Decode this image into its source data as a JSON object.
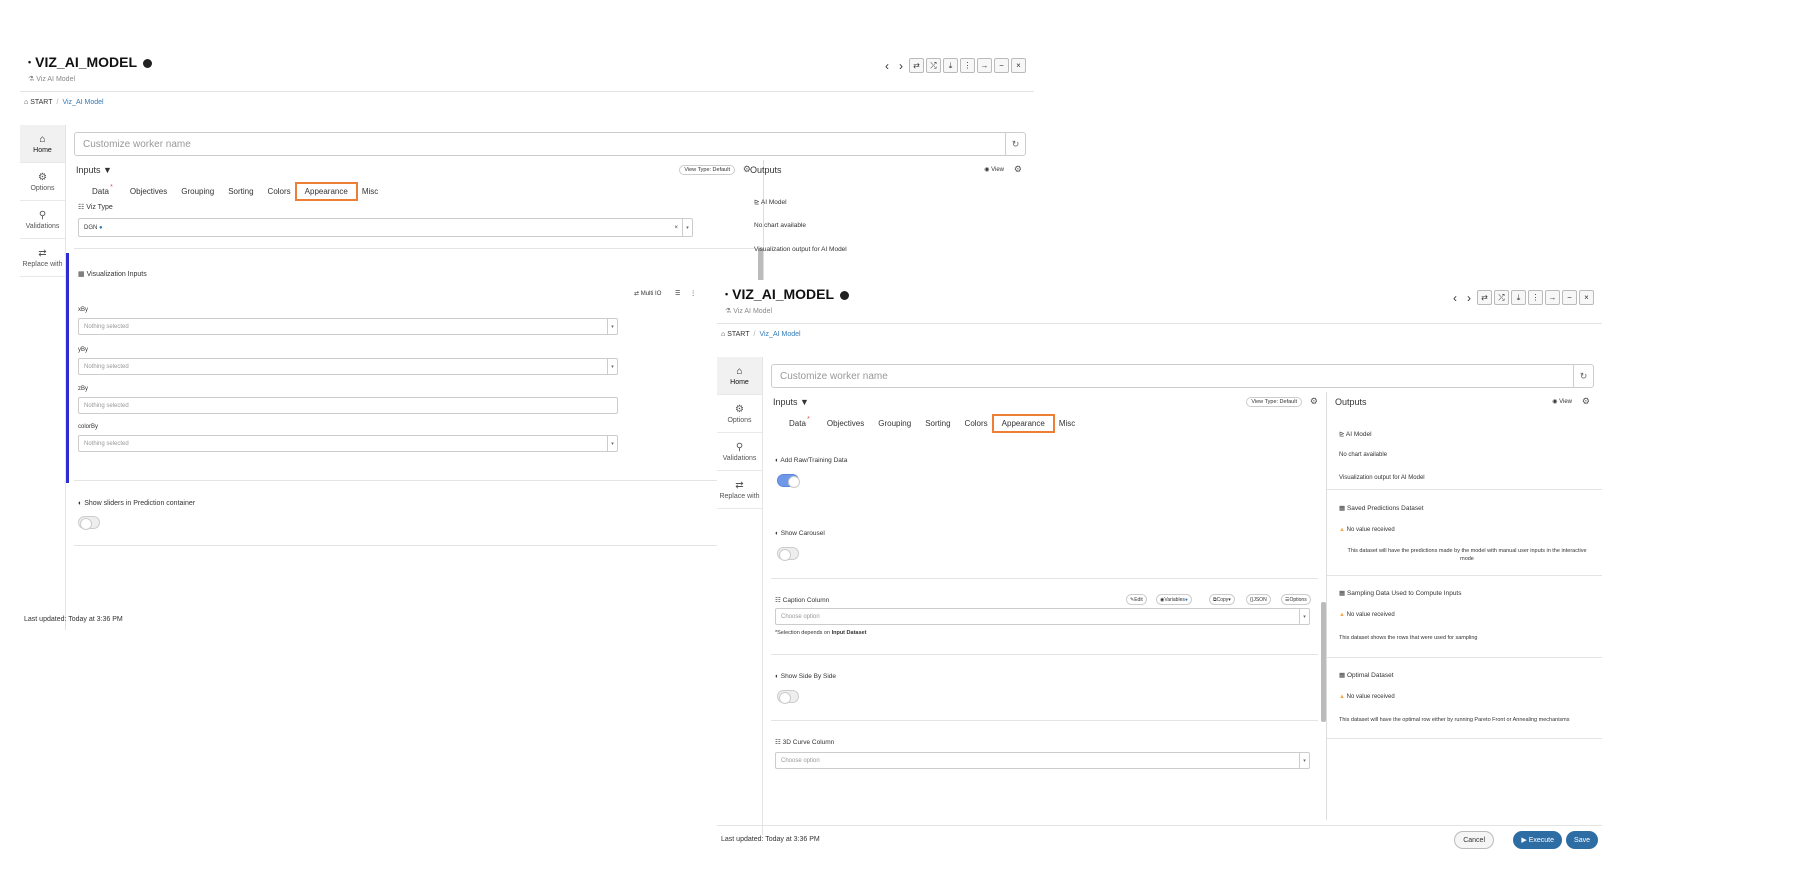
{
  "title": "VIZ_AI_MODEL",
  "subtitle": "Viz AI Model",
  "breadcrumb": {
    "start": "START",
    "current": "Viz_AI Model"
  },
  "worker_placeholder": "Customize worker name",
  "sidebar": [
    {
      "icon": "home-icon",
      "label": "Home"
    },
    {
      "icon": "gear-icon",
      "label": "Options"
    },
    {
      "icon": "check-icon",
      "label": "Validations"
    },
    {
      "icon": "swap-icon",
      "label": "Replace with"
    }
  ],
  "inputs_title": "Inputs",
  "view_type": "View Type: Default",
  "tabs": [
    "Data",
    "Objectives",
    "Grouping",
    "Sorting",
    "Colors",
    "Appearance",
    "Misc"
  ],
  "active_tab": "Appearance",
  "outputs_title": "Outputs",
  "view_label": "View",
  "w1": {
    "viz_type_label": "Viz Type",
    "viz_type_value": "DGN",
    "viz_inputs_label": "Visualization Inputs",
    "multi_io": "Multi IO",
    "fields": [
      {
        "label": "xBy",
        "value": "Nothing selected"
      },
      {
        "label": "yBy",
        "value": "Nothing selected"
      },
      {
        "label": "zBy",
        "value": "Nothing selected"
      },
      {
        "label": "colorBy",
        "value": "Nothing selected"
      }
    ],
    "sliders_label": "Show sliders in Prediction container",
    "outputs": {
      "ai_model": "AI Model",
      "no_chart": "No chart available",
      "viz_output": "Visualization output for AI Model"
    }
  },
  "w2": {
    "add_raw": "Add Raw/Training Data",
    "show_carousel": "Show Carousel",
    "caption_column": "Caption Column",
    "caption_buttons": [
      "Edit",
      "Variables",
      "Copy",
      "JSON",
      "Options"
    ],
    "choose": "Choose option",
    "selection_note": "*Selection depends on ",
    "selection_bold": "Input Dataset",
    "side_by_side": "Show Side By Side",
    "curve_column": "3D Curve Column",
    "outputs": [
      {
        "title": "AI Model",
        "line1": "No chart available",
        "line2": "Visualization output for AI Model"
      },
      {
        "title": "Saved Predictions Dataset",
        "warn": "No value received",
        "desc": "This dataset will have the predictions made by the model with manual user inputs in the interactive mode"
      },
      {
        "title": "Sampling Data Used to Compute Inputs",
        "warn": "No value received",
        "desc": "This dataset shows the rows that were used for sampling"
      },
      {
        "title": "Optimal Dataset",
        "warn": "No value received",
        "desc": "This dataset will have the optimal row either by running Pareto Front or Annealing mechanisms"
      }
    ],
    "cancel": "Cancel",
    "execute": "Execute",
    "save": "Save"
  },
  "last_updated": "Last updated: Today at 3:36 PM",
  "colors": {
    "accent": "#ee7d35",
    "link": "#337ab7",
    "primary": "#2e6da4"
  }
}
